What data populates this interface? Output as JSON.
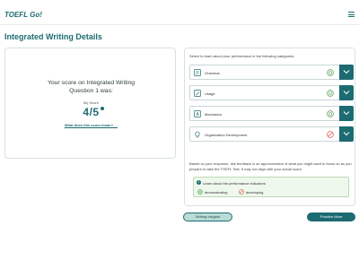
{
  "header": {
    "brand": "TOEFL Go!",
    "menu_icon": "hamburger-menu-icon"
  },
  "page": {
    "title": "Integrated Writing Details"
  },
  "score_card": {
    "heading_line1": "Your score on Integrated Writing",
    "heading_line2": "Question 1 was:",
    "sub_label": "My Score",
    "score": "4/5",
    "link": "What does this score mean? →"
  },
  "categories_panel": {
    "intro": "Select to learn about your performance in the following categories.",
    "items": [
      {
        "label": "Grammar",
        "icon": "grammar-icon",
        "status": "demonstrating"
      },
      {
        "label": "Usage",
        "icon": "usage-icon",
        "status": "demonstrating"
      },
      {
        "label": "Mechanics",
        "icon": "mechanics-icon",
        "status": "demonstrating"
      },
      {
        "label": "Organization Development",
        "icon": "lightbulb-icon",
        "status": "developing"
      }
    ],
    "feedback_note": "Based on your response, this feedback is an approximation of what you might want to focus on as you prepare to take the TOEFL Test. It may not align with your actual score.",
    "legend": {
      "title": "Learn about the performance indicators",
      "demonstrating": "demonstrating",
      "developing": "developing"
    }
  },
  "actions": {
    "insights": "Writing Insights",
    "practice": "Practice More"
  },
  "colors": {
    "accent": "#1d6b72",
    "demonstrating": "#4e9a4a",
    "developing": "#d9534f"
  }
}
